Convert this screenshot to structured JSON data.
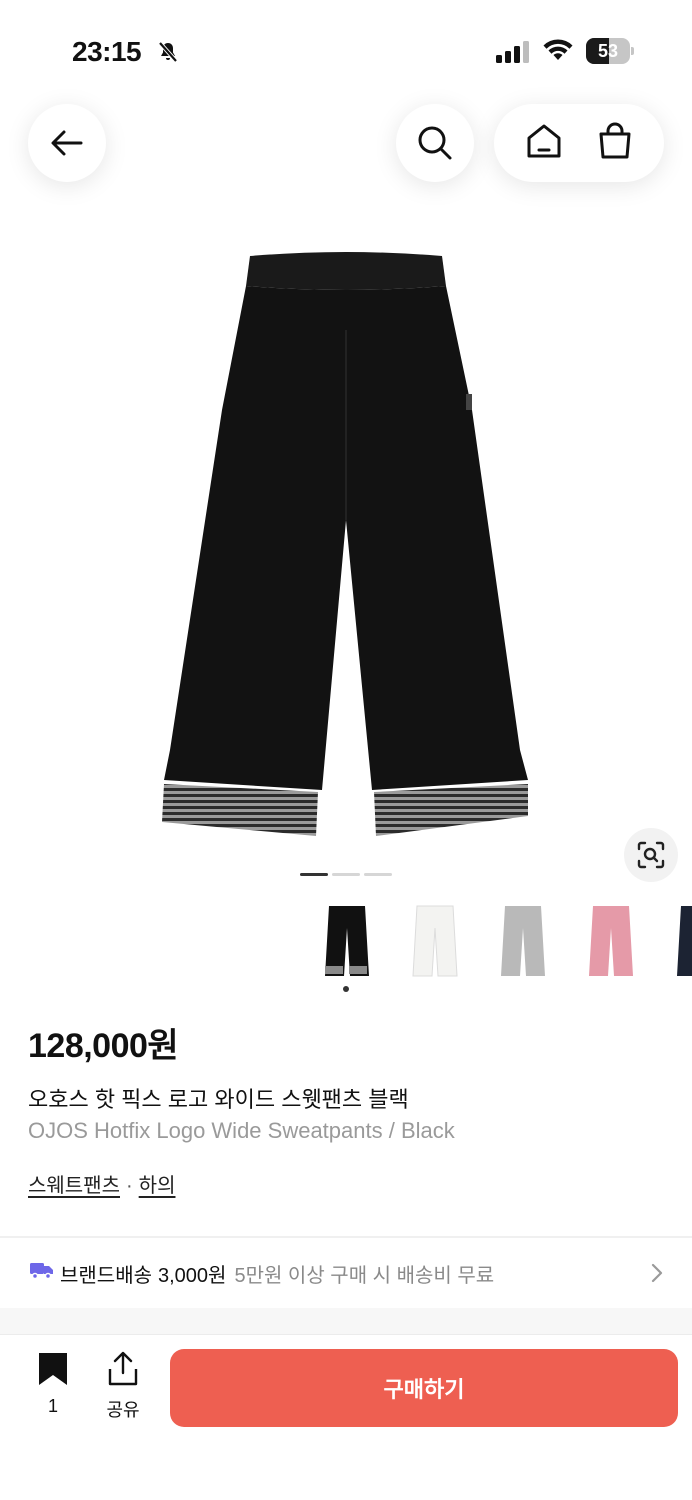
{
  "status_bar": {
    "time": "23:15",
    "battery": "53",
    "battery_level": 0.53,
    "icons": [
      "bell-slash-icon",
      "cellular-signal-icon",
      "wifi-icon",
      "battery-icon"
    ]
  },
  "top_nav": {
    "icons": [
      "back-arrow-icon",
      "search-icon",
      "home-icon",
      "shopping-bag-icon"
    ]
  },
  "gallery": {
    "current_page": 1,
    "total_pages": 3,
    "thumbnails": [
      {
        "color": "#111111",
        "name": "black",
        "selected": true
      },
      {
        "color": "#f3f3f1",
        "name": "white",
        "selected": false
      },
      {
        "color": "#b9b9b9",
        "name": "gray",
        "selected": false
      },
      {
        "color": "#e59aa8",
        "name": "pink",
        "selected": false
      },
      {
        "color": "#1c2333",
        "name": "navy",
        "selected": false
      }
    ]
  },
  "product": {
    "price": "128,000원",
    "name_ko": "오호스 핫 픽스 로고 와이드 스웻팬츠 블랙",
    "name_en": "OJOS Hotfix Logo Wide Sweatpants / Black",
    "category_1": "스웨트팬츠",
    "category_separator": "·",
    "category_2": "하의"
  },
  "shipping": {
    "label": "브랜드배송",
    "price": "3,000원",
    "note": "5만원 이상 구매 시 배송비 무료",
    "icon_color": "#6e67e8"
  },
  "bottom_bar": {
    "bookmark_count": "1",
    "share_label": "공유",
    "buy_label": "구매하기",
    "buy_color": "#ee5f51"
  }
}
